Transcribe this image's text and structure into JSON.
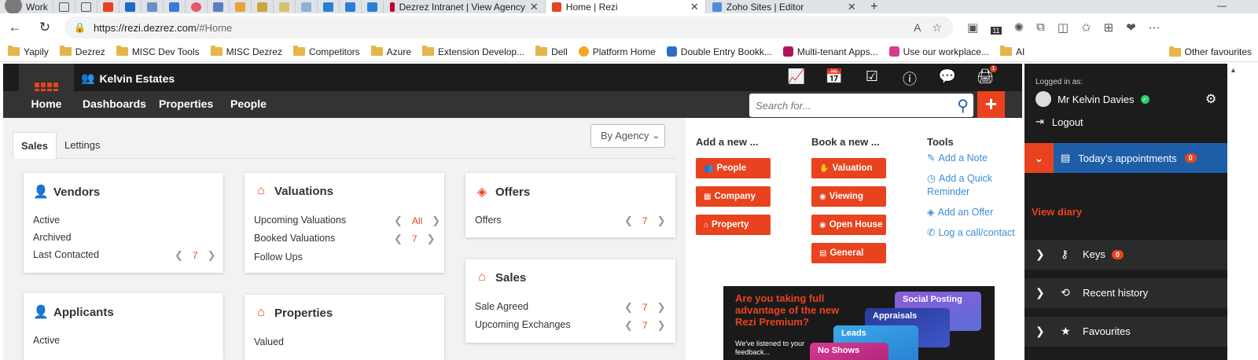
{
  "browser": {
    "profile_label": "Work",
    "tabs": [
      {
        "title": "Dezrez Intranet | View Agency"
      },
      {
        "title": "Home | Rezi"
      },
      {
        "title": "Zoho Sites | Editor"
      }
    ],
    "url_host": "https://rezi.dezrez.com",
    "url_path": "/#Home",
    "ext_badge": "11"
  },
  "bookmarks": {
    "items": [
      {
        "label": "Yapily"
      },
      {
        "label": "Dezrez"
      },
      {
        "label": "MISC Dev Tools"
      },
      {
        "label": "MISC Dezrez"
      },
      {
        "label": "Competitors"
      },
      {
        "label": "Azure"
      },
      {
        "label": "Extension Develop..."
      },
      {
        "label": "Dell"
      },
      {
        "label": "Platform Home"
      },
      {
        "label": "Double Entry Bookk..."
      },
      {
        "label": "Multi-tenant Apps..."
      },
      {
        "label": "Use our workplace..."
      },
      {
        "label": "AI"
      }
    ],
    "other": "Other favourites"
  },
  "app": {
    "brand": "Kelvin Estates",
    "nav": [
      "Home",
      "Dashboards",
      "Properties",
      "People"
    ],
    "search_placeholder": "Search for...",
    "print_badge": "1"
  },
  "dashboard": {
    "tabs": [
      "Sales",
      "Lettings"
    ],
    "agency_filter": "By Agency",
    "vendors": {
      "title": "Vendors",
      "rows": [
        "Active",
        "Archived",
        "Last Contacted"
      ],
      "last_contacted": "7"
    },
    "valuations": {
      "title": "Valuations",
      "rows": [
        "Upcoming Valuations",
        "Booked Valuations",
        "Follow Ups"
      ],
      "upcoming": "All",
      "booked": "7"
    },
    "offers": {
      "title": "Offers",
      "rows": [
        "Offers"
      ],
      "offers": "7"
    },
    "sales": {
      "title": "Sales",
      "rows": [
        "Sale Agreed",
        "Upcoming Exchanges"
      ],
      "sale_agreed": "7",
      "upcoming_exchanges": "7"
    },
    "applicants": {
      "title": "Applicants",
      "rows": [
        "Active"
      ]
    },
    "properties": {
      "title": "Properties",
      "rows": [
        "Valued"
      ]
    }
  },
  "quick": {
    "add_head": "Add a new ...",
    "add": [
      "People",
      "Company",
      "Property"
    ],
    "book_head": "Book a new ...",
    "book": [
      "Valuation",
      "Viewing",
      "Open House",
      "General"
    ],
    "tools_head": "Tools",
    "tools": [
      "Add a Note",
      "Add a Quick Reminder",
      "Add an Offer",
      "Log a call/contact"
    ]
  },
  "promo": {
    "title": "Are you taking full advantage of the new Rezi Premium?",
    "sub": "We've listened to your feedback...",
    "cards": [
      "Social Posting",
      "Appraisals",
      "Leads",
      "No Shows"
    ]
  },
  "sidebar": {
    "logged_in_as": "Logged in as:",
    "user": "Mr Kelvin Davies",
    "logout": "Logout",
    "appointments": "Today's appointments",
    "appointments_count": "0",
    "view_diary": "View diary",
    "keys": "Keys",
    "keys_count": "0",
    "recent": "Recent history",
    "favourites": "Favourites"
  },
  "colors": {
    "accent": "#e8431e",
    "blue": "#1e5ea8",
    "dark": "#1c1c1c",
    "link": "#3b8ed8"
  }
}
